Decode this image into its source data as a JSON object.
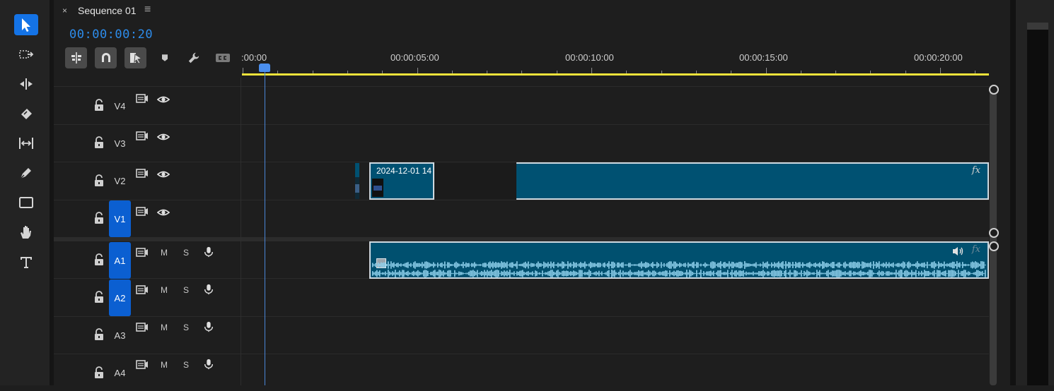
{
  "tools": [
    {
      "name": "selection-tool-icon",
      "active": true
    },
    {
      "name": "track-select-forward-tool-icon",
      "active": false
    },
    {
      "name": "ripple-edit-tool-icon",
      "active": false
    },
    {
      "name": "razor-tool-icon",
      "active": false
    },
    {
      "name": "slip-tool-icon",
      "active": false
    },
    {
      "name": "pen-tool-icon",
      "active": false
    },
    {
      "name": "rectangle-tool-icon",
      "active": false
    },
    {
      "name": "hand-tool-icon",
      "active": false
    },
    {
      "name": "type-tool-icon",
      "active": false
    }
  ],
  "sequence": {
    "close_glyph": "×",
    "tab_title": "Sequence 01",
    "menu_glyph": "≡",
    "timecode": "00:00:00:20"
  },
  "ruler": {
    "labels": [
      ":00:00",
      "00:00:05:00",
      "00:00:10:00",
      "00:00:15:00",
      "00:00:20:00"
    ]
  },
  "tracks": {
    "video": [
      {
        "label": "V4",
        "targeted": false
      },
      {
        "label": "V3",
        "targeted": false
      },
      {
        "label": "V2",
        "targeted": false
      },
      {
        "label": "V1",
        "targeted": true
      }
    ],
    "audio": [
      {
        "label": "A1",
        "targeted": true,
        "mute": "M",
        "solo": "S"
      },
      {
        "label": "A2",
        "targeted": true,
        "mute": "M",
        "solo": "S"
      },
      {
        "label": "A3",
        "targeted": false,
        "mute": "M",
        "solo": "S"
      },
      {
        "label": "A4",
        "targeted": false,
        "mute": "M",
        "solo": "S"
      }
    ]
  },
  "clips": {
    "video_clip_label": "2024-12-01 14",
    "fx_label": "fx"
  },
  "colors": {
    "accent": "#1473e6",
    "timecode": "#2d8ceb",
    "work_area": "#f0e33a",
    "clip": "#005172"
  }
}
